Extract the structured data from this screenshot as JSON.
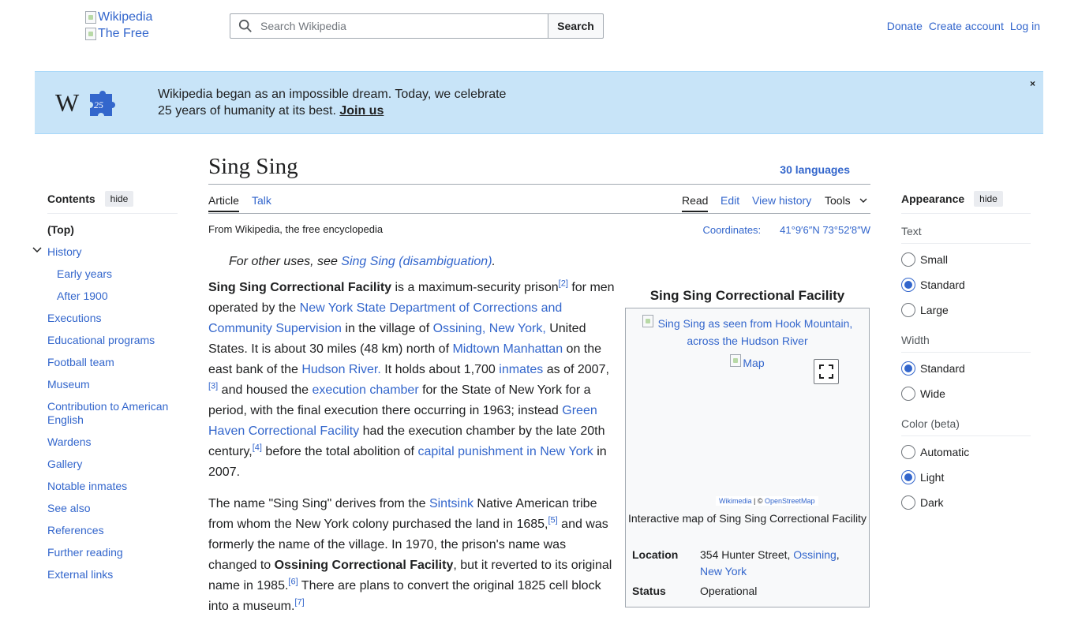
{
  "header": {
    "logo_alt": "Wikipedia",
    "logo_alt_2": "The Free",
    "search_placeholder": "Search Wikipedia",
    "search_button": "Search",
    "donate": "Donate",
    "create_account": "Create account",
    "log_in": "Log in"
  },
  "banner": {
    "line1": "Wikipedia began as an impossible dream. Today, we celebrate",
    "line2": "25 years of humanity at its best.",
    "join": "Join us",
    "close": "×"
  },
  "toc": {
    "title": "Contents",
    "hide": "hide",
    "items": [
      {
        "label": "(Top)"
      },
      {
        "label": "History"
      },
      {
        "label": "Early years"
      },
      {
        "label": "After 1900"
      },
      {
        "label": "Executions"
      },
      {
        "label": "Educational programs"
      },
      {
        "label": "Football team"
      },
      {
        "label": "Museum"
      },
      {
        "label": "Contribution to American English"
      },
      {
        "label": "Wardens"
      },
      {
        "label": "Gallery"
      },
      {
        "label": "Notable inmates"
      },
      {
        "label": "See also"
      },
      {
        "label": "References"
      },
      {
        "label": "Further reading"
      },
      {
        "label": "External links"
      }
    ]
  },
  "appearance": {
    "title": "Appearance",
    "hide": "hide",
    "text_label": "Text",
    "text_options": [
      "Small",
      "Standard",
      "Large"
    ],
    "width_label": "Width",
    "width_options": [
      "Standard",
      "Wide"
    ],
    "color_label": "Color (beta)",
    "color_options": [
      "Automatic",
      "Light",
      "Dark"
    ]
  },
  "article": {
    "title": "Sing Sing",
    "languages": "30 languages",
    "tabs": {
      "article": "Article",
      "talk": "Talk",
      "read": "Read",
      "edit": "Edit",
      "history": "View history",
      "tools": "Tools"
    },
    "tagline": "From Wikipedia, the free encyclopedia",
    "coords_label": "Coordinates:",
    "coords_value": "41°9′6″N 73°52′8″W",
    "hatnote_prefix": "For other uses, see",
    "hatnote_link": "Sing Sing (disambiguation)",
    "hatnote_suffix": "."
  },
  "p1": {
    "bold": "Sing Sing Correctional Facility",
    "t1": " is a maximum-security prison",
    "r2": "[2]",
    "t2": " for men operated by the ",
    "l1": "New York State Department of Corrections and Community Supervision",
    "t3": " in the village of ",
    "l2": "Ossining, New York,",
    "t4": " United States. It is about 30 miles (48 km) north of ",
    "l3": "Midtown Manhattan",
    "t5": " on the east bank of the ",
    "l4": "Hudson River.",
    "t6": " It holds about 1,700 ",
    "l5": "inmates",
    "t7": " as of 2007,",
    "r3": "[3]",
    "t8": " and housed the ",
    "l6": "execution chamber",
    "t9": " for the State of New York for a period, with the final execution there occurring in 1963; instead ",
    "l7": "Green Haven Correctional Facility",
    "t10": " had the execution chamber by the late 20th century,",
    "r4": "[4]",
    "t11": " before the total abolition of ",
    "l8": "capital punishment in New York",
    "t12": " in 2007."
  },
  "p2": {
    "t1": "The name \"Sing Sing\" derives from the ",
    "l1": "Sintsink",
    "t2": " Native American tribe from whom the New York colony purchased the land in 1685,",
    "r5": "[5]",
    "t3": " and was formerly the name of the village. In 1970, the prison's name was changed to ",
    "bold": "Ossining Correctional Facility",
    "t4": ", but it reverted to its original name in 1985.",
    "r6": "[6]",
    "t5": " There are plans to convert the original 1825 cell block into a ",
    "t6": "museum.",
    "r7": "[7]"
  },
  "infobox": {
    "caption": "Sing Sing Correctional Facility",
    "image_alt": "Sing Sing as seen from Hook Mountain, across the Hudson River",
    "map_alt": "Map",
    "attrib_wikimedia": "Wikimedia",
    "attrib_sep": "| ©",
    "attrib_osm": "OpenStreetMap",
    "map_caption": "Interactive map of Sing Sing Correctional Facility",
    "location_key": "Location",
    "location_text": "354 Hunter Street, ",
    "location_link1": "Ossining",
    "location_comma": ",",
    "location_link2": "New York",
    "status_key": "Status",
    "status_value": "Operational"
  }
}
